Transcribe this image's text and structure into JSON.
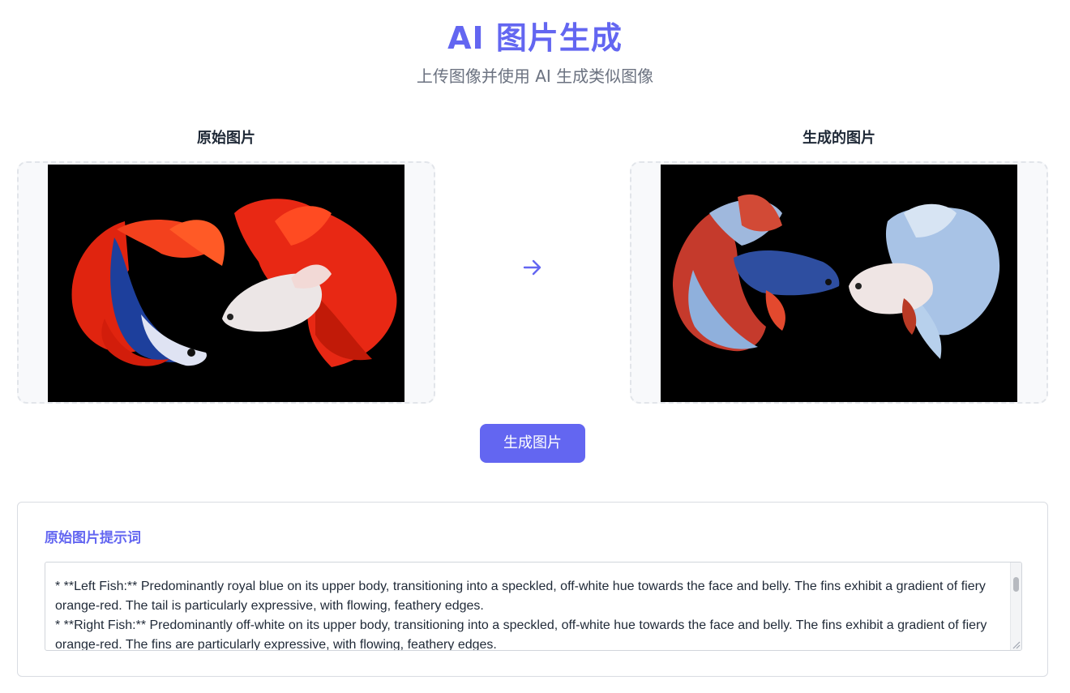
{
  "header": {
    "title": "AI 图片生成",
    "subtitle": "上传图像并使用 AI 生成类似图像"
  },
  "original_panel": {
    "heading": "原始图片",
    "image": "betta-fish-pair-red-blue"
  },
  "generated_panel": {
    "heading": "生成的图片",
    "image": "betta-fish-pair-blue-white"
  },
  "arrow_icon": "arrow-right-icon",
  "generate_button": {
    "label": "生成图片"
  },
  "prompt_section": {
    "title": "原始图片提示词",
    "lines": [
      "*   **Left Fish:** Predominantly royal blue on its upper body, transitioning into a speckled, off-white hue towards the face and belly. The fins exhibit a gradient of fiery orange-red. The tail is particularly expressive, with flowing, feathery edges.",
      "*   **Right Fish:** Predominantly off-white on its upper body, transitioning into a speckled, off-white hue towards the face and belly. The fins exhibit a gradient of fiery orange-red. The fins are particularly expressive, with flowing, feathery edges."
    ]
  },
  "colors": {
    "accent": "#6366f1",
    "subtitle": "#6b7280",
    "text": "#1f2937"
  }
}
